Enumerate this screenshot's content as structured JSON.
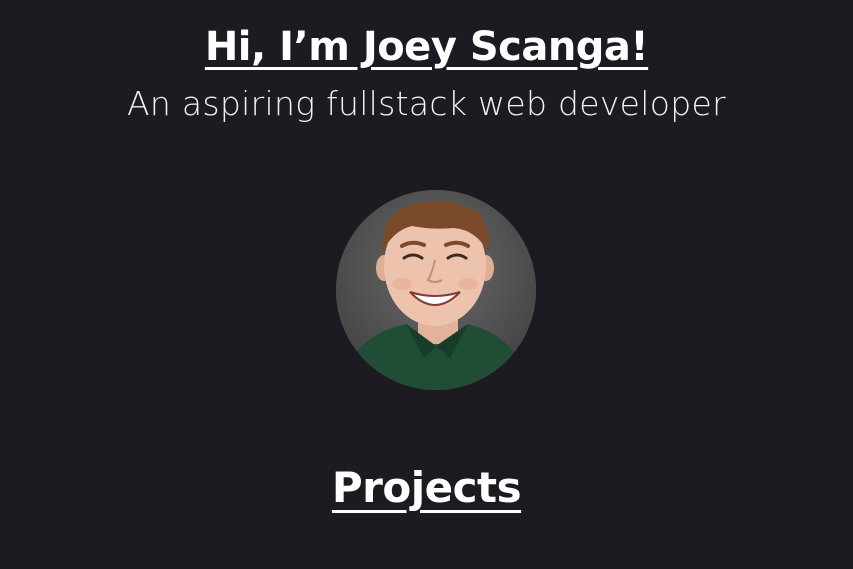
{
  "hero": {
    "title": "Hi, I’m Joey Scanga!",
    "subtitle": "An aspiring fullstack web developer"
  },
  "profile": {
    "photo_icon": "profile-photo"
  },
  "projects": {
    "heading": "Projects"
  },
  "colors": {
    "background": "#1d1b21",
    "text": "#ffffff"
  }
}
